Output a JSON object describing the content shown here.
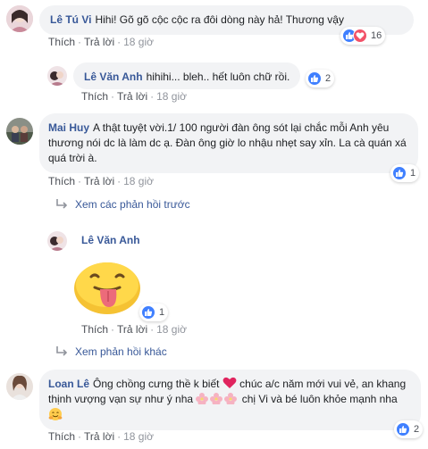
{
  "comments": [
    {
      "name": "Lê Tú Vi",
      "text": "Hihi! Gõ gõ cộc cộc ra đôi dòng này hả! Thương vậy",
      "like_label": "Thích",
      "reply_label": "Trả lời",
      "time": "18 giờ",
      "reaction_count": "16"
    },
    {
      "name": "Lê Văn Anh",
      "text": "hihihi... bleh.. hết luôn chữ rồi.",
      "like_label": "Thích",
      "reply_label": "Trả lời",
      "time": "18 giờ",
      "reaction_count": "2"
    },
    {
      "name": "Mai Huy",
      "text": "A thật tuyệt vời.1/ 100 người đàn ông sót lại chắc mỗi Anh yêu thương nói dc là làm dc ạ. Đàn ông giờ lo nhậu nhẹt say xỉn. La cà quán xá quá trời à.",
      "like_label": "Thích",
      "reply_label": "Trả lời",
      "time": "18 giờ",
      "reaction_count": "1"
    },
    {
      "name": "Lê Văn Anh",
      "like_label": "Thích",
      "reply_label": "Trả lời",
      "time": "18 giờ",
      "reaction_count": "1"
    },
    {
      "name": "Loan Lê",
      "text_1": "Ông chồng cưng thề k biết",
      "text_2": "chúc a/c năm mới vui vẻ, an khang thịnh vượng vạn sự như ý nha",
      "text_3": "chị Vi và bé luôn khỏe mạnh nha",
      "like_label": "Thích",
      "reply_label": "Trả lời",
      "time": "18 giờ",
      "reaction_count": "2"
    }
  ],
  "links": {
    "previous_replies": "Xem các phản hồi trước",
    "other_replies": "Xem phản hồi khác"
  },
  "colors": {
    "link": "#385898",
    "bubble": "#f2f3f5",
    "like": "#4080ff",
    "love": "#f25268"
  }
}
